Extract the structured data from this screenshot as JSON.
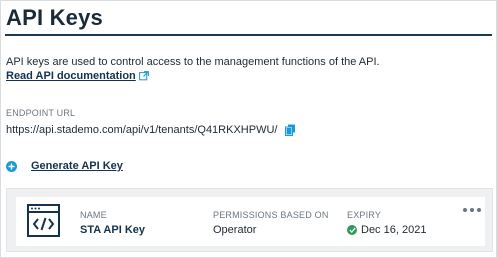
{
  "page": {
    "title": "API Keys",
    "description": "API keys are used to control access to the management functions of the API.",
    "doc_link_label": "Read API documentation"
  },
  "endpoint": {
    "label": "ENDPOINT URL",
    "url": "https://api.stademo.com/api/v1/tenants/Q41RKXHPWU/"
  },
  "actions": {
    "generate_label": "Generate API Key"
  },
  "key_card": {
    "icon": "code-window-icon",
    "name_label": "NAME",
    "name_value": "STA API Key",
    "permissions_label": "PERMISSIONS BASED ON",
    "permissions_value": "Operator",
    "expiry_label": "EXPIRY",
    "expiry_value": "Dec 16, 2021",
    "expiry_status": "valid"
  },
  "colors": {
    "title_rule": "#1d3a55",
    "accent_blue": "#1a9bd7",
    "status_green": "#2a9d57",
    "link_navy": "#14324d"
  }
}
